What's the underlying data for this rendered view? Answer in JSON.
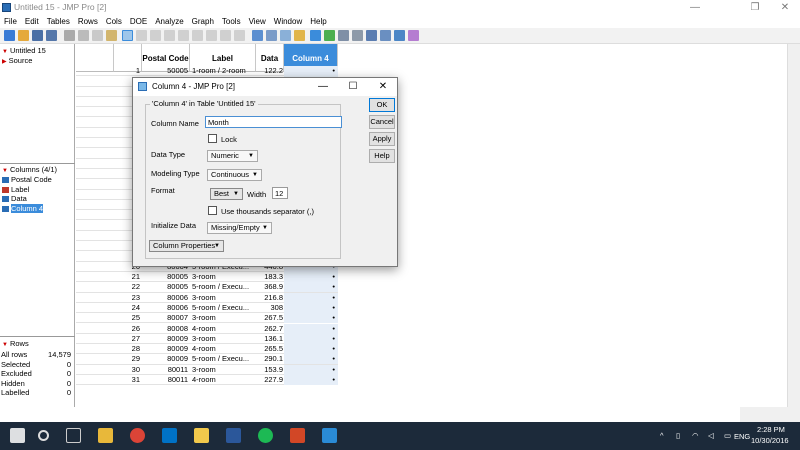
{
  "window": {
    "title": "Untitled 15 - JMP Pro [2]",
    "controls": [
      "—",
      "❐",
      "✕"
    ]
  },
  "menu": [
    "File",
    "Edit",
    "Tables",
    "Rows",
    "Cols",
    "DOE",
    "Analyze",
    "Graph",
    "Tools",
    "View",
    "Window",
    "Help"
  ],
  "left_panel": {
    "table_name": "Untitled 15",
    "source": "Source",
    "columns_header": "Columns (4/1)",
    "columns": [
      {
        "name": "Postal Code",
        "icon_color": "#2a6db5",
        "selected": false
      },
      {
        "name": "Label",
        "icon_color": "#c0392b",
        "selected": false
      },
      {
        "name": "Data",
        "icon_color": "#2a6db5",
        "selected": false
      },
      {
        "name": "Column 4",
        "icon_color": "#2a6db5",
        "selected": true
      }
    ],
    "rows_header": "Rows",
    "rows_summary": [
      {
        "k": "All rows",
        "v": "14,579"
      },
      {
        "k": "Selected",
        "v": "0"
      },
      {
        "k": "Excluded",
        "v": "0"
      },
      {
        "k": "Hidden",
        "v": "0"
      },
      {
        "k": "Labelled",
        "v": "0"
      }
    ]
  },
  "grid": {
    "headers": [
      "Postal Code",
      "Label",
      "Data",
      "Column 4"
    ],
    "rows": [
      {
        "n": "1",
        "pc": "50005",
        "lb": "1-room / 2-room",
        "d": "122.2",
        "c4": "•"
      },
      {
        "n": "19",
        "pc": "80004",
        "lb": "3-room",
        "d": "204.2",
        "c4": "•"
      },
      {
        "n": "20",
        "pc": "80004",
        "lb": "5-room / Execu...",
        "d": "446.8",
        "c4": "•"
      },
      {
        "n": "21",
        "pc": "80005",
        "lb": "3-room",
        "d": "183.3",
        "c4": "•"
      },
      {
        "n": "22",
        "pc": "80005",
        "lb": "5-room / Execu...",
        "d": "368.9",
        "c4": "•"
      },
      {
        "n": "23",
        "pc": "80006",
        "lb": "3-room",
        "d": "216.8",
        "c4": "•"
      },
      {
        "n": "24",
        "pc": "80006",
        "lb": "5-room / Execu...",
        "d": "308",
        "c4": "•"
      },
      {
        "n": "25",
        "pc": "80007",
        "lb": "3-room",
        "d": "267.5",
        "c4": "•"
      },
      {
        "n": "26",
        "pc": "80008",
        "lb": "4-room",
        "d": "262.7",
        "c4": "•"
      },
      {
        "n": "27",
        "pc": "80009",
        "lb": "3-room",
        "d": "136.1",
        "c4": "•"
      },
      {
        "n": "28",
        "pc": "80009",
        "lb": "4-room",
        "d": "265.5",
        "c4": "•"
      },
      {
        "n": "29",
        "pc": "80009",
        "lb": "5-room / Execu...",
        "d": "290.1",
        "c4": "•"
      },
      {
        "n": "30",
        "pc": "80011",
        "lb": "3-room",
        "d": "153.9",
        "c4": "•"
      },
      {
        "n": "31",
        "pc": "80011",
        "lb": "4-room",
        "d": "227.9",
        "c4": "•"
      }
    ],
    "partial_row_numbers": [
      "10",
      "11",
      "12",
      "13",
      "14",
      "15",
      "16",
      "17",
      "18"
    ]
  },
  "dialog": {
    "title": "Column 4 - JMP Pro [2]",
    "group_label": "'Column 4' in Table 'Untitled 15'",
    "column_name_label": "Column Name",
    "column_name_value": "Month",
    "lock_label": "Lock",
    "data_type_label": "Data Type",
    "data_type_value": "Numeric",
    "modeling_type_label": "Modeling Type",
    "modeling_type_value": "Continuous",
    "format_label": "Format",
    "format_value": "Best",
    "width_label": "Width",
    "width_value": "12",
    "thousands_label": "Use thousands separator (,)",
    "init_label": "Initialize Data",
    "init_value": "Missing/Empty",
    "col_props_label": "Column Properties",
    "buttons": {
      "ok": "OK",
      "cancel": "Cancel",
      "apply": "Apply",
      "help": "Help"
    }
  },
  "taskbar": {
    "lang": "ENG",
    "time": "2:28 PM",
    "date": "10/30/2016"
  }
}
